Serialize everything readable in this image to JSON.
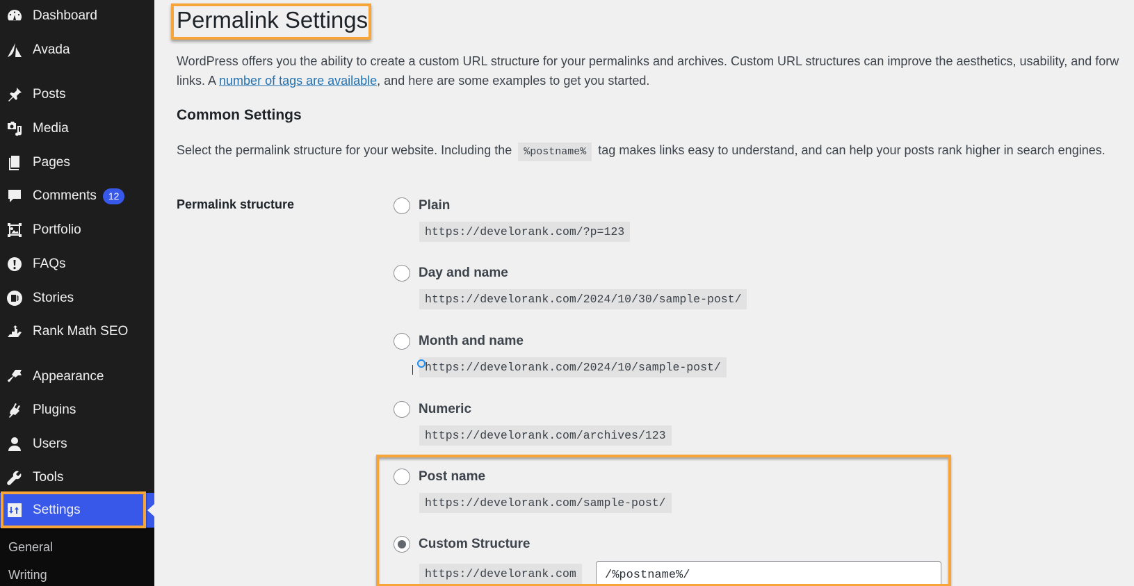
{
  "sidebar": {
    "items": [
      {
        "label": "Dashboard",
        "icon": "dashboard-icon"
      },
      {
        "label": "Avada",
        "icon": "avada-icon"
      },
      {
        "label": "Posts",
        "icon": "pushpin-icon"
      },
      {
        "label": "Media",
        "icon": "media-icon"
      },
      {
        "label": "Pages",
        "icon": "pages-icon"
      },
      {
        "label": "Comments",
        "icon": "comment-icon",
        "badge": "12"
      },
      {
        "label": "Portfolio",
        "icon": "portfolio-icon"
      },
      {
        "label": "FAQs",
        "icon": "exclamation-icon"
      },
      {
        "label": "Stories",
        "icon": "stories-icon"
      },
      {
        "label": "Rank Math SEO",
        "icon": "rank-math-icon"
      },
      {
        "label": "Appearance",
        "icon": "paintbrush-icon"
      },
      {
        "label": "Plugins",
        "icon": "plug-icon"
      },
      {
        "label": "Users",
        "icon": "user-icon"
      },
      {
        "label": "Tools",
        "icon": "wrench-icon"
      },
      {
        "label": "Settings",
        "icon": "settings-icon",
        "current": true
      }
    ],
    "submenu": [
      "General",
      "Writing"
    ],
    "accent_color": "#3858e9",
    "highlight_color": "#f7a539"
  },
  "page": {
    "title": "Permalink Settings",
    "intro_before_link": "WordPress offers you the ability to create a custom URL structure for your permalinks and archives. Custom URL structures can improve the aesthetics, usability, and forw",
    "intro_line2_before": "links. A ",
    "intro_link": "number of tags are available",
    "intro_line2_after": ", and here are some examples to get you started.",
    "section_title": "Common Settings",
    "section_desc_before": "Select the permalink structure for your website. Including the",
    "section_desc_code": "%postname%",
    "section_desc_after": "tag makes links easy to understand, and can help your posts rank higher in search engines.",
    "field_label": "Permalink structure"
  },
  "options": [
    {
      "label": "Plain",
      "example": "https://develorank.com/?p=123",
      "checked": false
    },
    {
      "label": "Day and name",
      "example": "https://develorank.com/2024/10/30/sample-post/",
      "checked": false
    },
    {
      "label": "Month and name",
      "example": "https://develorank.com/2024/10/sample-post/",
      "checked": false
    },
    {
      "label": "Numeric",
      "example": "https://develorank.com/archives/123",
      "checked": false
    },
    {
      "label": "Post name",
      "example": "https://develorank.com/sample-post/",
      "checked": false
    },
    {
      "label": "Custom Structure",
      "example": "https://develorank.com",
      "checked": true,
      "value": "/%postname%/"
    }
  ]
}
